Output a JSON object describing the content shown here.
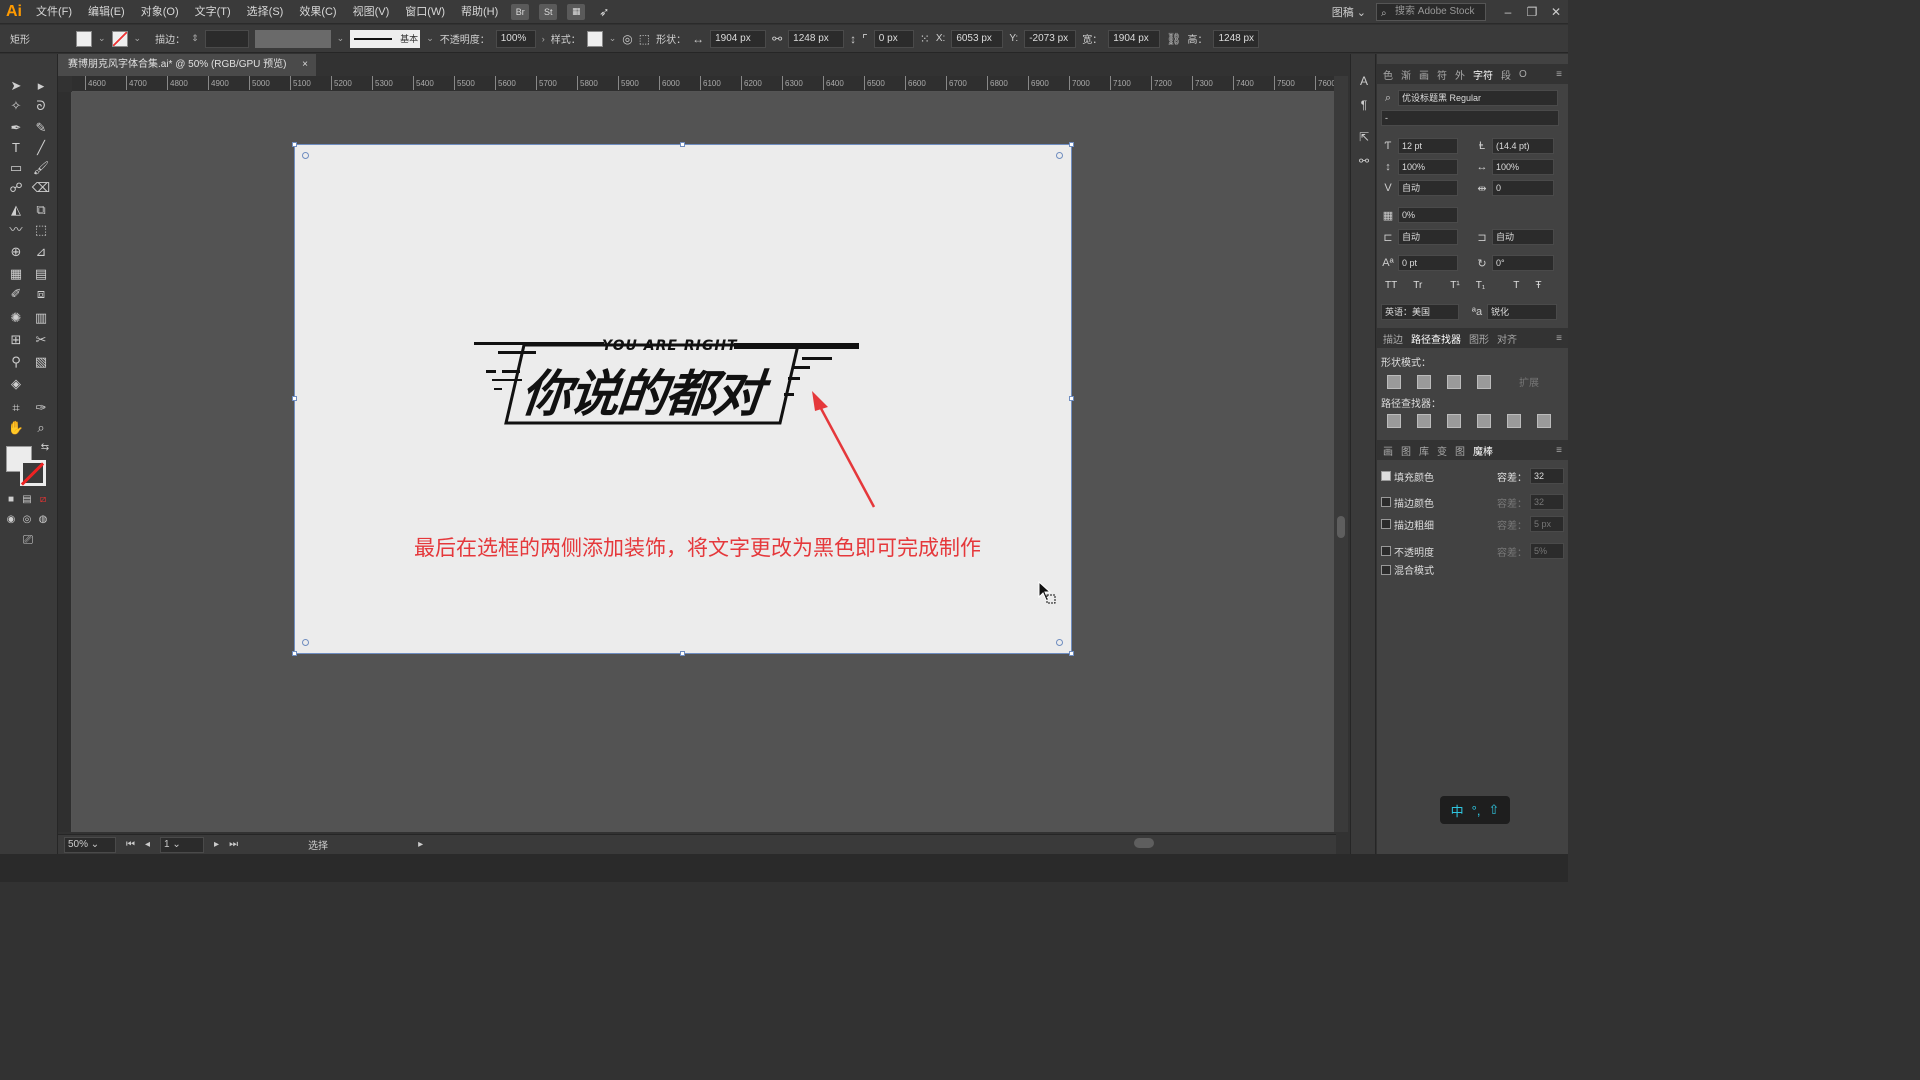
{
  "app": {
    "logo": "Ai",
    "menu": [
      "文件(F)",
      "编辑(E)",
      "对象(O)",
      "文字(T)",
      "选择(S)",
      "效果(C)",
      "视图(V)",
      "窗口(W)",
      "帮助(H)"
    ],
    "menu_icons": [
      "Br",
      "St"
    ],
    "workspace": "图稿",
    "stock_search_placeholder": "搜索 Adobe Stock"
  },
  "control_bar": {
    "object_type": "矩形",
    "stroke_label": "描边：",
    "stroke_style": "基本",
    "opacity_label": "不透明度：",
    "opacity_value": "100%",
    "style_label": "样式：",
    "shape_label": "形状：",
    "shape_w": "1904 px",
    "shape_h": "1248 px",
    "corner_radius": "0 px",
    "x_label": "X:",
    "x_value": "6053 px",
    "y_label": "Y:",
    "y_value": "-2073 px",
    "w_label": "宽：",
    "w_value": "1904 px",
    "h_label": "高：",
    "h_value": "1248 px"
  },
  "document": {
    "tab_title": "赛博朋克风字体合集.ai* @ 50% (RGB/GPU 预览)",
    "close": "×"
  },
  "ruler_h_ticks": [
    "4600",
    "4700",
    "4800",
    "4900",
    "5000",
    "5100",
    "5200",
    "5300",
    "5400",
    "5500",
    "5600",
    "5700",
    "5800",
    "5900",
    "6000",
    "6100",
    "6200",
    "6300",
    "6400",
    "6500",
    "6600",
    "6700",
    "6800",
    "6900",
    "7000",
    "7100",
    "7200",
    "7300",
    "7400",
    "7500",
    "7600"
  ],
  "artboard": {
    "small_title": "YOU ARE RIGHT",
    "main_title": "你说的都对",
    "caption": "最后在选框的两侧添加装饰，将文字更改为黑色即可完成制作"
  },
  "status": {
    "zoom": "50%",
    "page": "1",
    "mode": "选择"
  },
  "character_panel": {
    "tabs": [
      "色",
      "渐",
      "画",
      "符",
      "外",
      "字符",
      "段",
      "O"
    ],
    "active_tab": "字符",
    "font_family": "优设标题黑 Regular",
    "font_style": "-",
    "font_size": "12 pt",
    "leading": "(14.4 pt)",
    "vertical_scale": "100%",
    "horizontal_scale": "100%",
    "kerning": "自动",
    "tracking": "0",
    "tsume": "0%",
    "aki_left": "自动",
    "aki_right": "自动",
    "baseline_shift": "0 pt",
    "rotation": "0°",
    "type_buttons": [
      "TT",
      "Tr",
      "T¹",
      "T₁",
      "T",
      "Ŧ"
    ],
    "language": "英语：美国",
    "antialias": "锐化"
  },
  "pathfinder_panel": {
    "tabs": [
      "描边",
      "路径查找器",
      "图形",
      "对齐"
    ],
    "active_tab": "路径查找器",
    "shape_modes_label": "形状模式：",
    "expand_label": "扩展",
    "pathfinders_label": "路径查找器："
  },
  "magic_wand_panel": {
    "tabs": [
      "画",
      "图",
      "库",
      "变",
      "图",
      "魔棒"
    ],
    "active_tab": "魔棒",
    "rows": [
      {
        "label": "填充颜色",
        "checked": true,
        "tol_label": "容差：",
        "tol_value": "32"
      },
      {
        "label": "描边颜色",
        "checked": false,
        "tol_label": "容差：",
        "tol_value": "32"
      },
      {
        "label": "描边粗细",
        "checked": false,
        "tol_label": "容差：",
        "tol_value": "5 px"
      },
      {
        "label": "不透明度",
        "checked": false,
        "tol_label": "容差：",
        "tol_value": "5%"
      },
      {
        "label": "混合模式",
        "checked": false
      }
    ]
  },
  "ime": {
    "lang": "中",
    "punct": "°,",
    "shift": "⇧"
  },
  "colors": {
    "accent_logo": "#ff9a00",
    "caption_red": "#e5383b",
    "selection_blue": "#6f8dc0",
    "artboard_bg": "#ececec",
    "ime_cyan": "#2fc6e0"
  }
}
